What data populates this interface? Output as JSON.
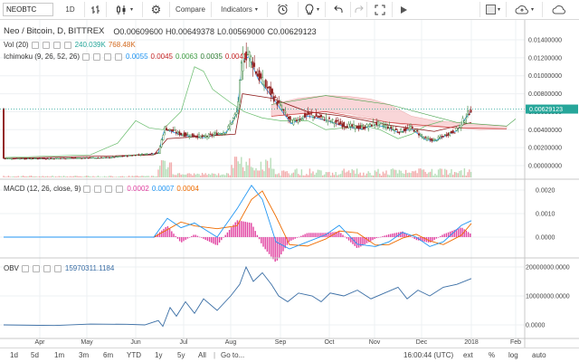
{
  "toolbar": {
    "symbol": "NEOBTC",
    "interval": "1D",
    "compare_label": "Compare",
    "indicators_label": "Indicators"
  },
  "legend": {
    "main_title": "Neo / Bitcoin, D, BITTREX",
    "o": "O0.00609600",
    "h": "H0.00649378",
    "l": "L0.00569000",
    "c": "C0.00629123",
    "vol_label": "Vol (20)",
    "vol_a": "240.039K",
    "vol_b": "768.48K",
    "ichi_label": "Ichimoku (9, 26, 52, 26)",
    "ichi_1": "0.0055",
    "ichi_2": "0.0045",
    "ichi_3": "0.0063",
    "ichi_4": "0.0035",
    "ichi_5": "0.0041",
    "macd_label": "MACD (12, 26, close, 9)",
    "macd_1": "0.0002",
    "macd_2": "0.0007",
    "macd_3": "0.0004",
    "obv_label": "OBV",
    "obv_value": "15970311.1184"
  },
  "price_axis": {
    "ticks": [
      "0.01400000",
      "0.01200000",
      "0.01000000",
      "0.00800000",
      "0.00600000",
      "0.00400000",
      "0.00200000",
      "0.00000000"
    ],
    "current_price": "0.00629123"
  },
  "macd_axis": {
    "ticks": [
      "0.0020",
      "0.0010",
      "0.0000"
    ]
  },
  "obv_axis": {
    "ticks": [
      "20000000.0000",
      "10000000.0000",
      "0.0000"
    ]
  },
  "time_axis": {
    "labels": [
      "Apr",
      "May",
      "Jun",
      "Jul",
      "Aug",
      "Sep",
      "Oct",
      "Nov",
      "Dec",
      "2018",
      "Feb"
    ]
  },
  "bottom_bar": {
    "ranges": [
      "1d",
      "5d",
      "1m",
      "3m",
      "6m",
      "YTD",
      "1y",
      "5y",
      "All"
    ],
    "goto": "Go to...",
    "time": "16:00:44 (UTC)",
    "ext": "ext",
    "pct": "%",
    "log": "log",
    "auto": "auto"
  },
  "colors": {
    "up": "#2e7d32",
    "down": "#8e1c1c",
    "line_blue": "#2196f3",
    "line_red": "#e53935",
    "line_green": "#4caf50",
    "obv_line": "#3a6ea5",
    "cloud": "#f8c9cc",
    "macd_hist": "#e040a0",
    "price_tag": "#26a69a"
  }
}
